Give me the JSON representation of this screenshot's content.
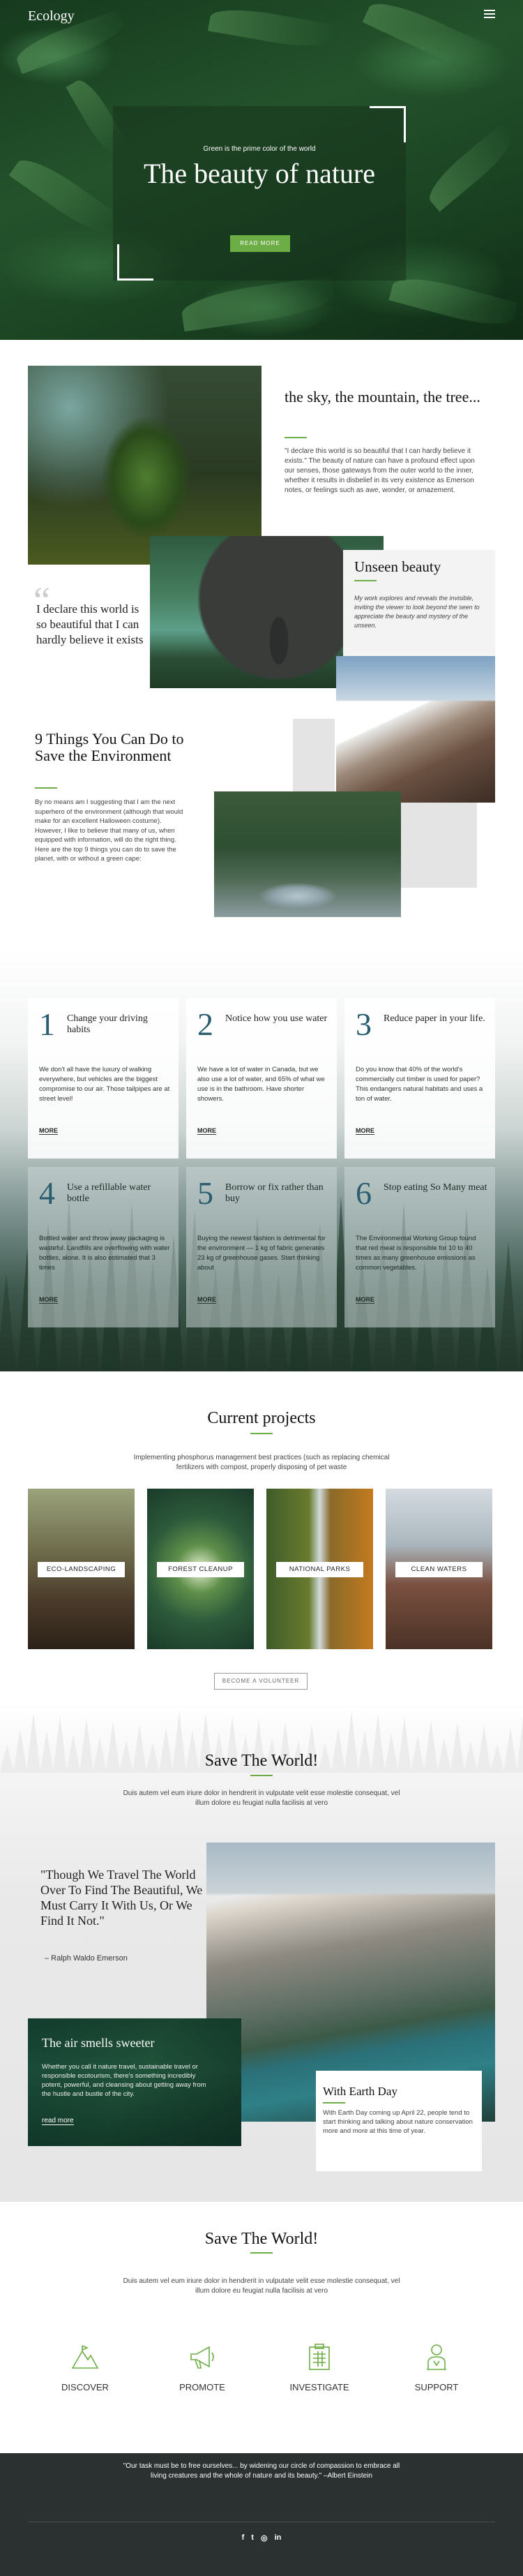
{
  "header": {
    "logo": "Ecology"
  },
  "hero": {
    "kicker": "Green is the prime color of the world",
    "title": "The beauty of nature",
    "button": "READ MORE"
  },
  "intro": {
    "title": "the sky, the mountain, the tree...",
    "text": "\"I declare this world is so beautiful that I can hardly believe it exists.\" The beauty of nature can have a profound effect upon our senses, those gateways from the outer world to the inner, whether it results in disbelief in its very existence as Emerson notes, or feelings such as awe, wonder, or amazement.",
    "quote": "I declare this world is so beautiful that I can hardly believe it exists",
    "unseen_title": "Unseen beauty",
    "unseen_text": "My work explores and reveals the invisible, inviting the viewer to look beyond the seen to appreciate the beauty and mystery of the unseen.",
    "things_title": "9 Things You Can Do to Save the Environment",
    "things_text": "By no means am I suggesting that I am the next superhero of the environment (although that would make for an excellent Halloween costume). However, I like to believe that many of us, when equipped with information, will do the right thing. Here are the top 9 things you can do to save the planet, with or without a green cape:"
  },
  "cards": [
    {
      "num": "1",
      "title": "Change your driving habits",
      "text": "We don't all have the luxury of walking everywhere, but vehicles are the biggest compromise to our air. Those tailpipes are at street level!",
      "more": "MORE"
    },
    {
      "num": "2",
      "title": "Notice how you use water",
      "text": "We have a lot of water in Canada, but we also use a lot of water, and 65% of what we use is in the bathroom. Have shorter showers.",
      "more": "MORE"
    },
    {
      "num": "3",
      "title": "Reduce paper in your life.",
      "text": "Do you know that 40% of the world's commercially cut timber is used for paper? This endangers natural habitats and uses a ton of water.",
      "more": "MORE"
    },
    {
      "num": "4",
      "title": "Use a refillable water bottle",
      "text": "Bottled water and throw away packaging is wasteful. Landfills are overflowing with water bottles, alone. It is also estimated that 3 times",
      "more": "MORE"
    },
    {
      "num": "5",
      "title": "Borrow or fix rather than buy",
      "text": "Buying the newest fashion is detrimental for the environment — 1 kg of fabric generates 23 kg of greenhouse gases. Start thinking about",
      "more": "MORE"
    },
    {
      "num": "6",
      "title": "Stop eating So Many meat",
      "text": "The Environmental Working Group found that red meat is responsible for 10 to 40 times as many greenhouse emissions as common vegetables.",
      "more": "MORE"
    }
  ],
  "projects": {
    "title": "Current projects",
    "text": "Implementing phosphorus management best practices (such as replacing chemical fertilizers with compost, properly disposing of pet waste",
    "items": [
      "ECO-LANDSCAPING",
      "FOREST CLEANUP",
      "NATIONAL PARKS",
      "CLEAN WATERS"
    ],
    "button": "BECOME A VOLUNTEER"
  },
  "save1": {
    "title": "Save The World!",
    "text": "Duis autem vel eum iriure dolor in hendrerit in vulputate velit esse molestie consequat, vel illum dolore eu feugiat nulla facilisis at vero",
    "quote": "\"Though We Travel The World Over To Find The Beautiful, We Must Carry It With Us, Or We Find It Not.\"",
    "author": "– Ralph Waldo Emerson",
    "air_title": "The air smells sweeter",
    "air_text": "Whether you call it nature travel, sustainable travel or responsible ecotourism, there's something incredibly potent, powerful, and cleansing about getting away from the hustle and bustle of the city.",
    "air_link": "read more",
    "earth_title": "With Earth Day",
    "earth_text": "With Earth Day coming up April 22, people tend to start thinking and talking about nature conservation more and more at this time of year."
  },
  "save2": {
    "title": "Save The World!",
    "text": "Duis autem vel eum iriure dolor in hendrerit in vulputate velit esse molestie consequat, vel illum dolore eu feugiat nulla facilisis at vero",
    "features": [
      {
        "label": "DISCOVER",
        "icon": "mountain-icon"
      },
      {
        "label": "PROMOTE",
        "icon": "megaphone-icon"
      },
      {
        "label": "INVESTIGATE",
        "icon": "clipboard-icon"
      },
      {
        "label": "SUPPORT",
        "icon": "person-icon"
      }
    ]
  },
  "footer": {
    "quote": "\"Our task must be to free ourselves... by widening our circle of compassion to embrace all living creatures and the whole of nature and its beauty.\" –Albert Einstein",
    "social": [
      "f",
      "t",
      "◎",
      "in"
    ]
  },
  "colors": {
    "accent": "#6dad45",
    "number": "#2b5d70",
    "footer": "#2b3130"
  }
}
